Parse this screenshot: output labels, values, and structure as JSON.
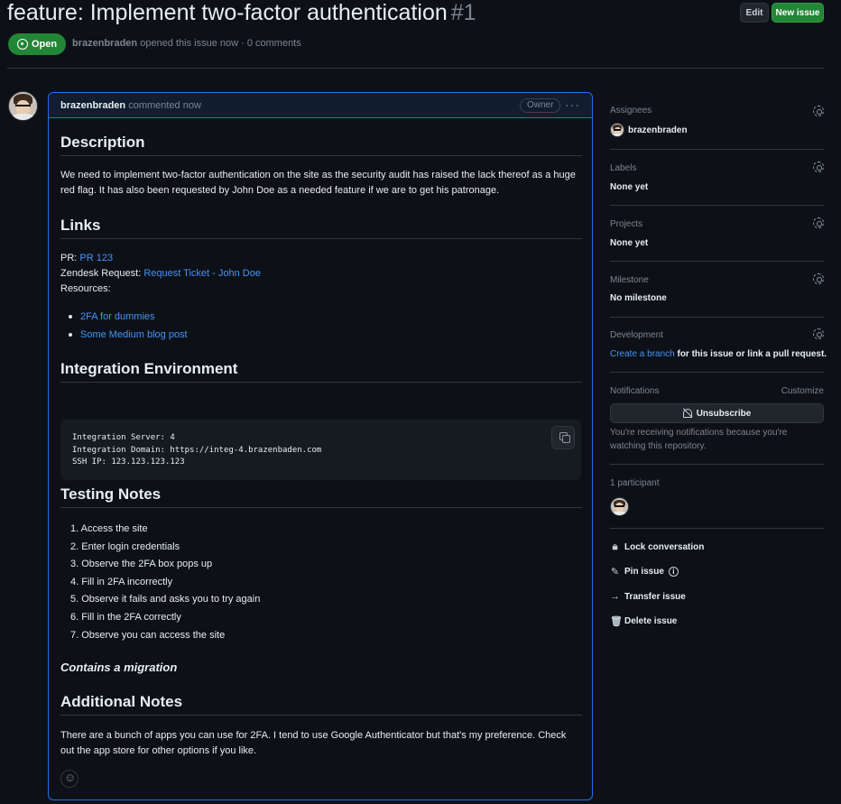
{
  "issue": {
    "title": "feature: Implement two-factor authentication",
    "number": "#1",
    "state": "Open",
    "author": "brazenbraden",
    "meta_text": "opened this issue now · 0 comments"
  },
  "header": {
    "edit_label": "Edit",
    "new_issue_label": "New issue"
  },
  "comment": {
    "author": "brazenbraden",
    "when": "commented now",
    "role_badge": "Owner",
    "menu_glyph": "···",
    "description_heading": "Description",
    "description_text": "We need to implement two-factor authentication on the site as the security audit has raised the lack thereof as a huge red flag. It has also been requested by John Doe as a needed feature if we are to get his patronage.",
    "links_heading": "Links",
    "pr_label": "PR: ",
    "pr_link": "PR 123",
    "zendesk_label": "Zendesk Request: ",
    "zendesk_link": "Request Ticket - John Doe",
    "resources_label": "Resources:",
    "resources": [
      "2FA for dummies",
      "Some Medium blog post"
    ],
    "integration_heading": "Integration Environment",
    "code": "Integration Server: 4\nIntegration Domain: https://integ-4.brazenbaden.com\nSSH IP: 123.123.123.123",
    "testing_heading": "Testing Notes",
    "steps": [
      "1. Access the site",
      "2. Enter login credentials",
      "3. Observe the 2FA box pops up",
      "4. Fill in 2FA incorrectly",
      "5. Observe it fails and asks you to try again",
      "6. Fill in the 2FA correctly",
      "7. Observe you can access the site"
    ],
    "migration_note": "Contains a migration",
    "additional_heading": "Additional Notes",
    "additional_text": "There are a bunch of apps you can use for 2FA. I tend to use Google Authenticator but that's my preference. Check out the app store for other options if you like."
  },
  "sidebar": {
    "assignees_label": "Assignees",
    "assignee": "brazenbraden",
    "labels_label": "Labels",
    "labels_value": "None yet",
    "projects_label": "Projects",
    "projects_value": "None yet",
    "milestone_label": "Milestone",
    "milestone_value": "No milestone",
    "development_label": "Development",
    "dev_link": "Create a branch",
    "dev_text": " for this issue or link a pull request.",
    "notifications_label": "Notifications",
    "customize_label": "Customize",
    "unsubscribe_label": "Unsubscribe",
    "notif_note": "You're receiving notifications because you're watching this repository.",
    "participants_label": "1 participant",
    "actions": {
      "lock": "Lock conversation",
      "pin": "Pin issue",
      "transfer": "Transfer issue",
      "delete": "Delete issue"
    }
  },
  "colors": {
    "accent": "#1f6feb",
    "link": "#4493f8",
    "open_green": "#238636",
    "bg": "#0d1117"
  }
}
